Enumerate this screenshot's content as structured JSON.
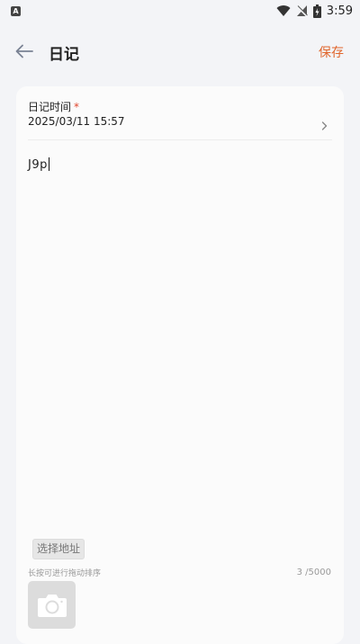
{
  "status_bar": {
    "notification_icon": "a-square-icon",
    "notification_glyph": "A",
    "icons": [
      "wifi-icon",
      "signal-off-icon",
      "battery-charging-icon"
    ],
    "time": "3:59"
  },
  "header": {
    "back_icon": "arrow-left-icon",
    "title": "日记",
    "save_label": "保存",
    "save_color": "#e0662d"
  },
  "form": {
    "time_label": "日记时间",
    "required_mark": "*",
    "time_value": "2025/03/11 15:57",
    "chevron_icon": "chevron-right-icon",
    "content_value": "J9p",
    "address_button_label": "选择地址",
    "sort_hint": "长按可进行拖动排序",
    "char_count": "3 /5000",
    "photo_icon": "camera-icon"
  }
}
